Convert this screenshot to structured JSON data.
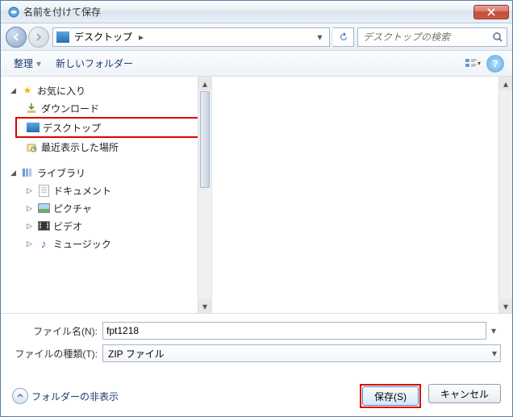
{
  "title": "名前を付けて保存",
  "nav": {
    "location": "デスクトップ",
    "search_placeholder": "デスクトップの検索"
  },
  "toolbar": {
    "organize": "整理",
    "new_folder": "新しいフォルダー"
  },
  "tree": {
    "favorites": {
      "label": "お気に入り",
      "items": [
        {
          "key": "downloads",
          "label": "ダウンロード"
        },
        {
          "key": "desktop",
          "label": "デスクトップ",
          "highlighted": true
        },
        {
          "key": "recent",
          "label": "最近表示した場所"
        }
      ]
    },
    "libraries": {
      "label": "ライブラリ",
      "items": [
        {
          "key": "documents",
          "label": "ドキュメント"
        },
        {
          "key": "pictures",
          "label": "ピクチャ"
        },
        {
          "key": "videos",
          "label": "ビデオ"
        },
        {
          "key": "music",
          "label": "ミュージック"
        }
      ]
    }
  },
  "fields": {
    "filename_label": "ファイル名(N):",
    "filename_value": "fpt1218",
    "filetype_label": "ファイルの種類(T):",
    "filetype_value": "ZIP ファイル"
  },
  "footer": {
    "hide_folders": "フォルダーの非表示",
    "save": "保存(S)",
    "cancel": "キャンセル"
  }
}
